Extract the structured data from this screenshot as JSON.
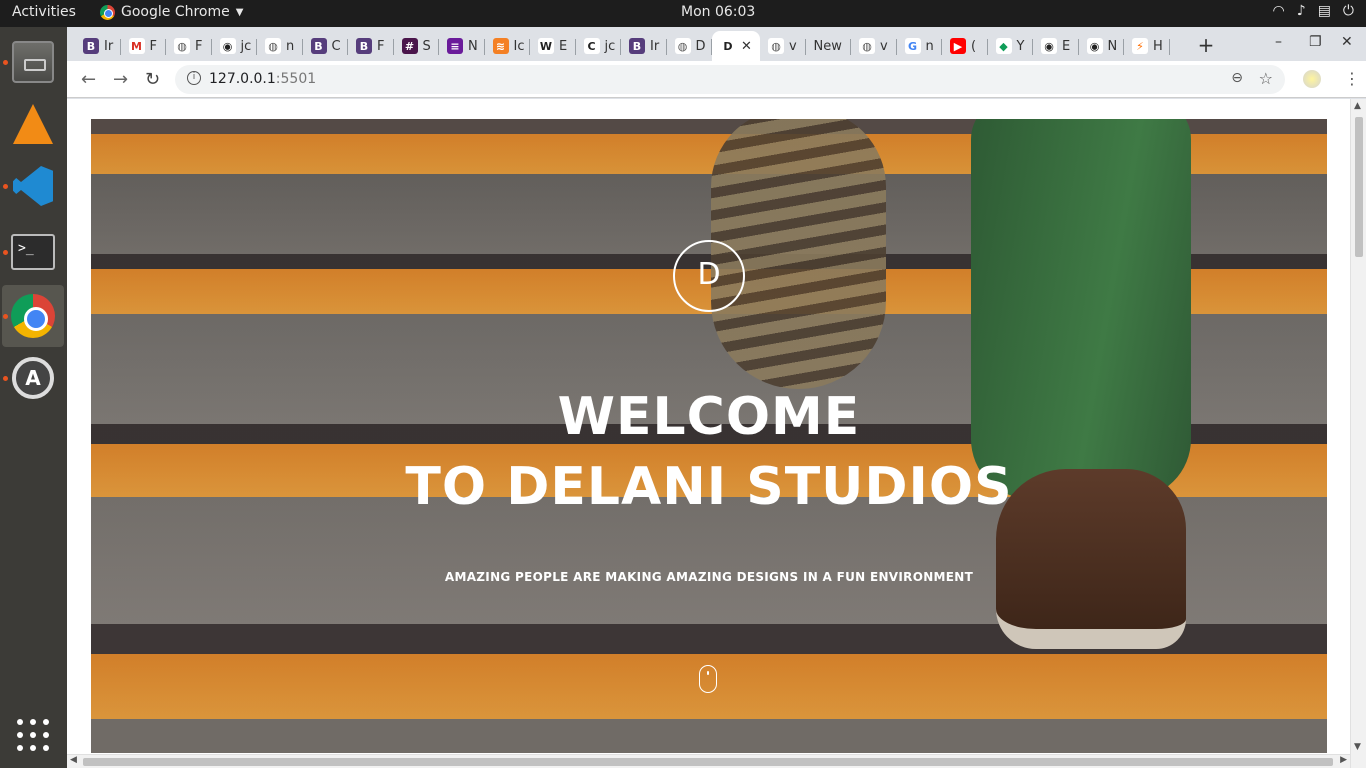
{
  "topbar": {
    "activities": "Activities",
    "app_name": "Google Chrome",
    "clock": "Mon 06:03",
    "tray_icons": [
      "wifi-icon",
      "volume-icon",
      "clipboard-icon",
      "power-icon"
    ]
  },
  "launcher": {
    "items": [
      "files-icon",
      "vlc-icon",
      "vscode-icon",
      "terminal-icon",
      "chrome-icon",
      "software-updater-icon",
      "show-apps-icon"
    ],
    "terminal_glyph": ">_",
    "updater_glyph": "A"
  },
  "tabs": [
    {
      "fav": "B",
      "text": "Ir",
      "color": "#563d7c"
    },
    {
      "fav": "M",
      "text": "F",
      "color": "#ffffff",
      "fg": "#d93025"
    },
    {
      "fav": "◍",
      "text": "F",
      "color": "#ffffff",
      "fg": "#555555"
    },
    {
      "fav": "◉",
      "text": "jc",
      "color": "#ffffff",
      "fg": "#222222"
    },
    {
      "fav": "◍",
      "text": "n",
      "color": "#ffffff",
      "fg": "#555555"
    },
    {
      "fav": "B",
      "text": "C",
      "color": "#563d7c"
    },
    {
      "fav": "B",
      "text": "F",
      "color": "#563d7c"
    },
    {
      "fav": "#",
      "text": "S",
      "color": "#4a154b"
    },
    {
      "fav": "≡",
      "text": "N",
      "color": "#6a1b9a"
    },
    {
      "fav": "≋",
      "text": "Ic",
      "color": "#f48024"
    },
    {
      "fav": "W",
      "text": "E",
      "color": "#ffffff",
      "fg": "#222222"
    },
    {
      "fav": "C",
      "text": "jc",
      "color": "#ffffff",
      "fg": "#222222"
    },
    {
      "fav": "B",
      "text": "Ir",
      "color": "#563d7c"
    },
    {
      "fav": "◍",
      "text": "D",
      "color": "#ffffff",
      "fg": "#555555"
    },
    {
      "fav": "D",
      "text": "✕",
      "color": "#ffffff",
      "fg": "#222222",
      "active": true
    },
    {
      "fav": "◍",
      "text": "v",
      "color": "#ffffff",
      "fg": "#555555"
    },
    {
      "fav": "",
      "text": "New",
      "color": "#ffffff",
      "fg": "#222222"
    },
    {
      "fav": "◍",
      "text": "v",
      "color": "#ffffff",
      "fg": "#555555"
    },
    {
      "fav": "G",
      "text": "n",
      "color": "#ffffff",
      "fg": "#4285f4"
    },
    {
      "fav": "▶",
      "text": "(",
      "color": "#ff0000"
    },
    {
      "fav": "◆",
      "text": "Y",
      "color": "#ffffff",
      "fg": "#0f9d58"
    },
    {
      "fav": "◉",
      "text": "E",
      "color": "#ffffff",
      "fg": "#222222"
    },
    {
      "fav": "◉",
      "text": "N",
      "color": "#ffffff",
      "fg": "#222222"
    },
    {
      "fav": "⚡",
      "text": "H",
      "color": "#ffffff",
      "fg": "#ff6d00"
    }
  ],
  "window": {
    "new_tab": "+",
    "minimize": "–",
    "restore": "❐",
    "close": "✕"
  },
  "toolbar": {
    "back": "←",
    "forward": "→",
    "reload": "↻",
    "info": "i",
    "url_host": "127.0.0.1",
    "url_port": ":5501",
    "zoom": "⊖",
    "bookmark": "☆",
    "menu": "⋮"
  },
  "hero": {
    "logo_letter": "D",
    "headline_line1": "WELCOME",
    "headline_line2": "TO DELANI STUDIOS",
    "tagline": "AMAZING PEOPLE ARE MAKING AMAZING DESIGNS IN A FUN ENVIRONMENT"
  },
  "scrollbar": {
    "up": "▲",
    "down": "▼",
    "left": "◀",
    "right": "▶"
  }
}
